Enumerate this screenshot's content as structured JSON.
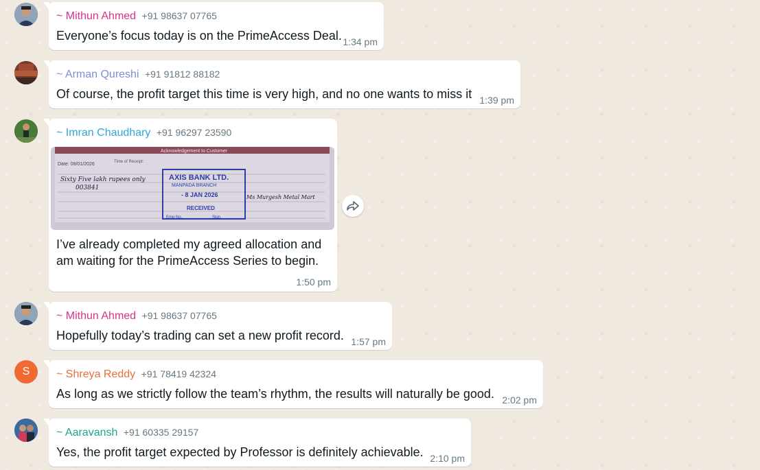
{
  "messages": [
    {
      "sender": "~ Mithun Ahmed",
      "phone": "+91 98637 07765",
      "text": "Everyone’s focus today is on the PrimeAccess Deal.",
      "time": "1:34 pm",
      "name_color": "#d6338a"
    },
    {
      "sender": "~ Arman Qureshi",
      "phone": "+91 91812 88182",
      "text": "Of course, the profit target this time is very high, and no one wants to miss it",
      "time": "1:39 pm",
      "name_color": "#7b8fd6"
    },
    {
      "sender": "~ Imran Chaudhary",
      "phone": "+91 96297 23590",
      "text_line1": "I’ve already completed my agreed allocation and",
      "text_line2": "am waiting for the PrimeAccess Series to begin.",
      "time": "1:50 pm",
      "name_color": "#35a6d6",
      "receipt": {
        "header": "Acknowledgement to Customer",
        "date": "Date: 08/01/2026",
        "time_label": "Time of Receipt:",
        "bank_stamp": "AXIS BANK LTD.",
        "branch": "MANPADA BRANCH",
        "stamp_date": "- 8 JAN 2026",
        "received": "RECEIVED",
        "emp": "Emp No.",
        "sign": "Sign",
        "handwritten_amount": "Sixty Five lakh rupees only",
        "cheque": "003841",
        "beneficiary": "Ms Murgesh Metal Mart"
      }
    },
    {
      "sender": "~ Mithun Ahmed",
      "phone": "+91 98637 07765",
      "text": "Hopefully today’s trading can set a new profit record.",
      "time": "1:57 pm",
      "name_color": "#d6338a"
    },
    {
      "sender": "~ Shreya Reddy",
      "phone": "+91 78419 42324",
      "text": "As long as we strictly follow the team’s rhythm, the results will naturally be good.",
      "time": "2:02 pm",
      "name_color": "#e8703a",
      "avatar_letter": "S",
      "avatar_color": "#f06a34"
    },
    {
      "sender": "~ Aaravansh",
      "phone": "+91 60335 29157",
      "text": "Yes, the profit target expected by Professor is definitely achievable.",
      "time": "2:10 pm",
      "name_color": "#1aa58f"
    }
  ]
}
